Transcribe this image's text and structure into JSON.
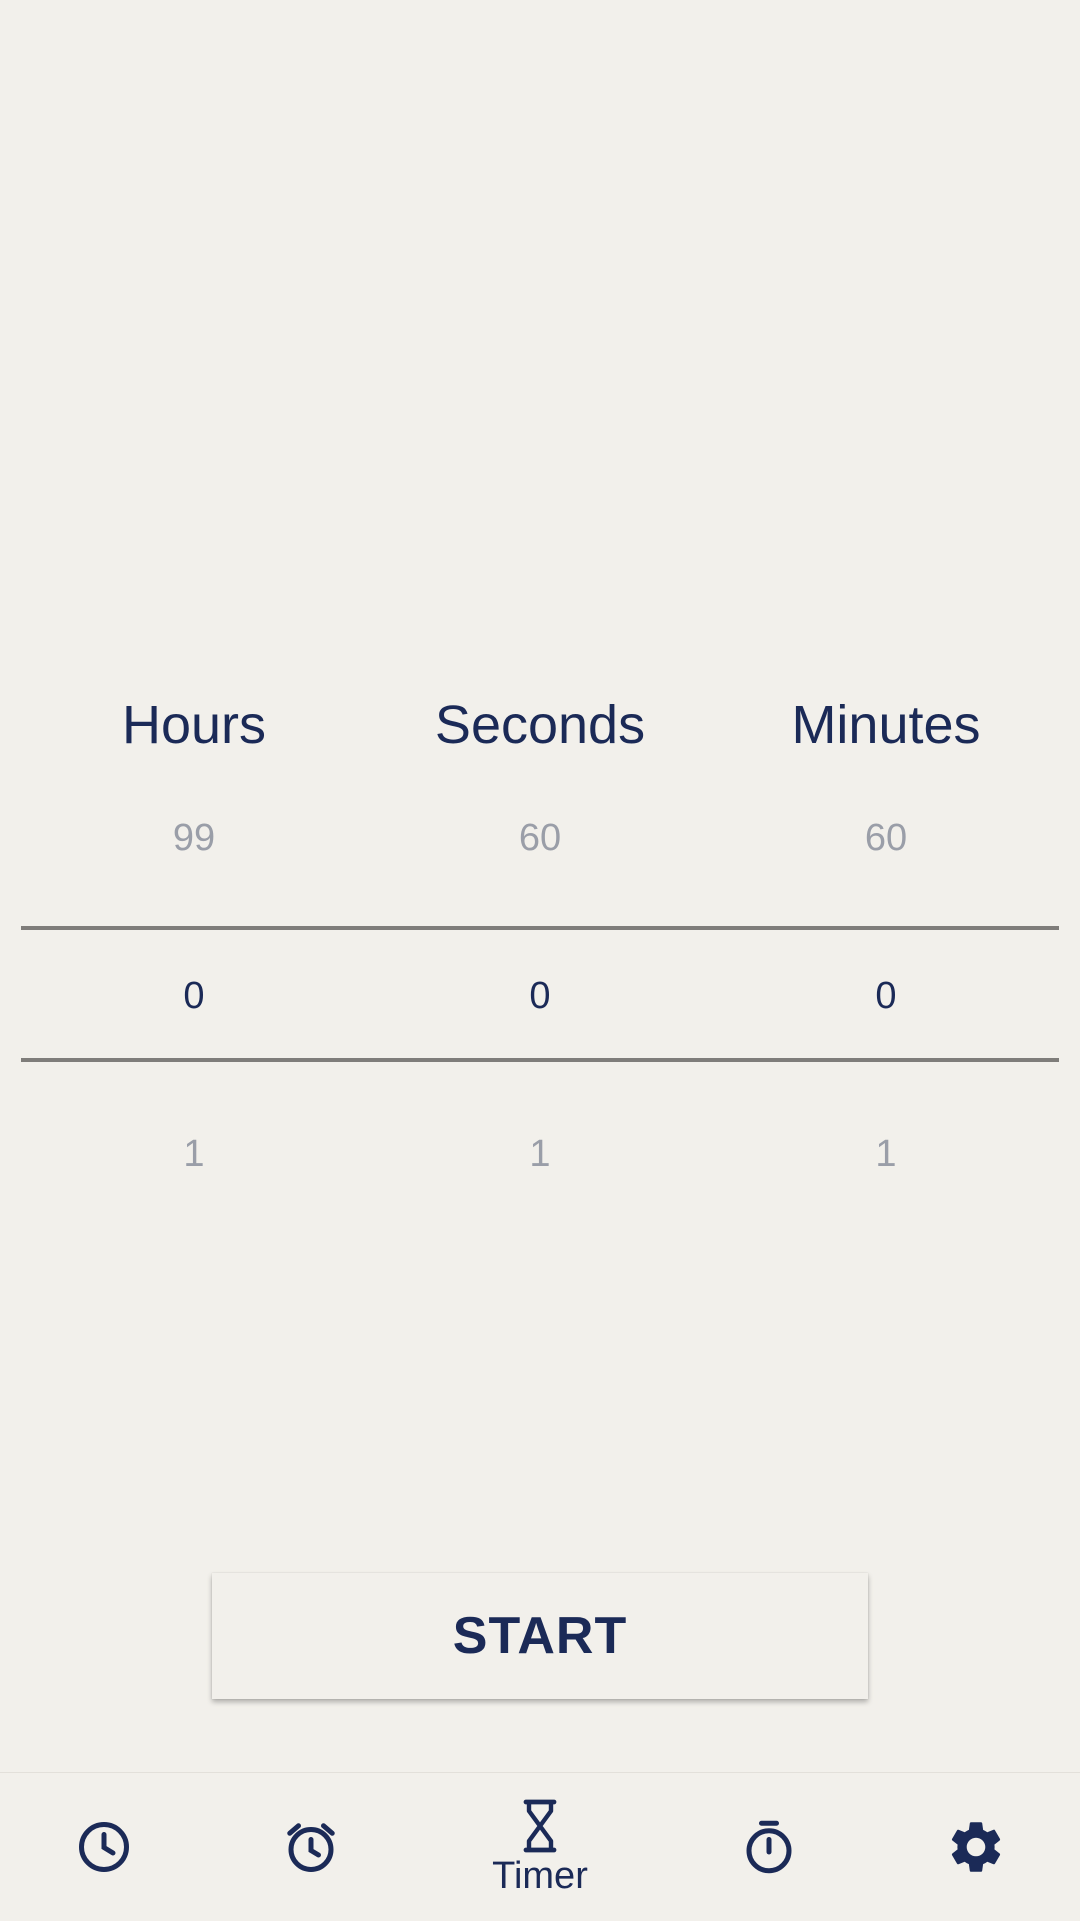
{
  "picker": {
    "columns": [
      {
        "label": "Hours",
        "prev": "99",
        "current": "0",
        "next": "1"
      },
      {
        "label": "Seconds",
        "prev": "60",
        "current": "0",
        "next": "1"
      },
      {
        "label": "Minutes",
        "prev": "60",
        "current": "0",
        "next": "1"
      }
    ]
  },
  "actions": {
    "start_label": "START"
  },
  "nav": {
    "items": [
      {
        "icon": "clock-icon",
        "label": ""
      },
      {
        "icon": "alarm-icon",
        "label": ""
      },
      {
        "icon": "hourglass-icon",
        "label": "Timer",
        "active": true
      },
      {
        "icon": "stopwatch-icon",
        "label": ""
      },
      {
        "icon": "gear-icon",
        "label": ""
      }
    ]
  },
  "colors": {
    "background": "#f2f0eb",
    "primary": "#1b2a57",
    "muted": "#9a9ea8",
    "divider": "#7f7d7a"
  }
}
